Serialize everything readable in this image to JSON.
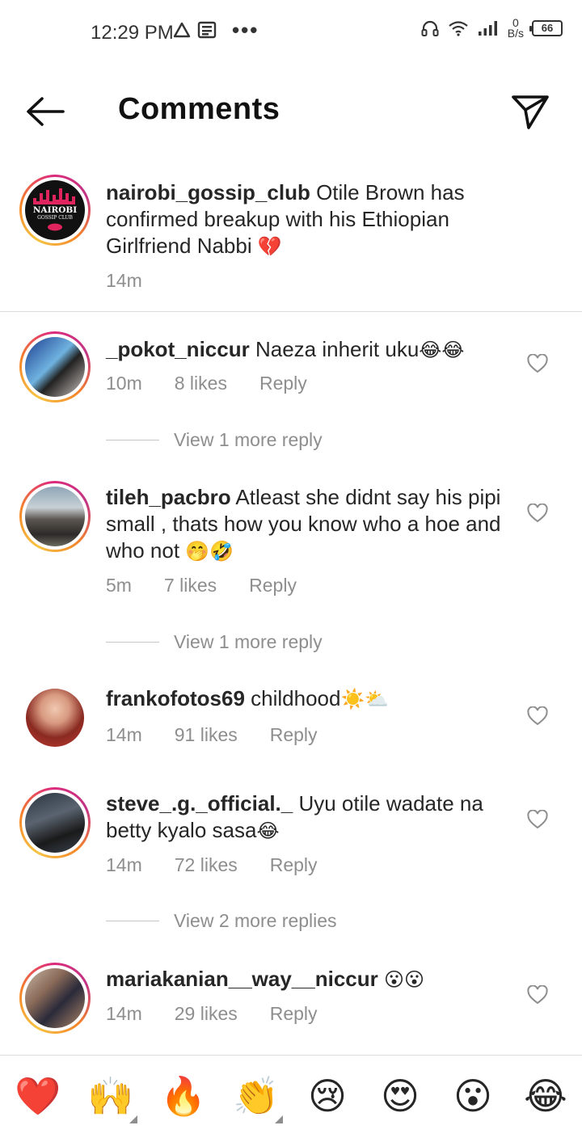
{
  "status_bar": {
    "time": "12:29 PM",
    "speed_top": "0",
    "speed_bottom": "B/s",
    "battery": "66"
  },
  "header": {
    "title": "Comments"
  },
  "caption": {
    "username": "nairobi_gossip_club",
    "text": "Otile Brown has confirmed breakup with his Ethiopian Girlfriend Nabbi",
    "emoji": "💔",
    "time": "14m",
    "avatar_line1": "NAIROBI",
    "avatar_line2": "GOSSIP CLUB"
  },
  "comments": [
    {
      "username": "_pokot_niccur",
      "text": "Naeza inherit uku",
      "emoji": "😂😂",
      "time": "10m",
      "likes": "8 likes",
      "reply": "Reply",
      "view_more": "View 1 more reply"
    },
    {
      "username": "tileh_pacbro",
      "text": "Atleast she didnt say his pipi small , thats how you know who a hoe and who not",
      "emoji": "🤭🤣",
      "time": "5m",
      "likes": "7 likes",
      "reply": "Reply",
      "view_more": "View 1 more reply"
    },
    {
      "username": "frankofotos69",
      "text": "childhood",
      "emoji": "☀️⛅",
      "time": "14m",
      "likes": "91 likes",
      "reply": "Reply"
    },
    {
      "username": "steve_.g._official._",
      "text": "Uyu otile wadate na betty kyalo sasa",
      "emoji": "😂",
      "time": "14m",
      "likes": "72 likes",
      "reply": "Reply",
      "view_more": "View 2 more replies"
    },
    {
      "username": "mariakanian__way__niccur",
      "text": "",
      "emoji": "😮😮",
      "time": "14m",
      "likes": "29 likes",
      "reply": "Reply"
    }
  ],
  "reactions": [
    "❤️",
    "🙌",
    "🔥",
    "👏",
    "😢",
    "😍",
    "😮",
    "😂"
  ],
  "colors": {
    "text": "#262626",
    "muted": "#8e8e8e",
    "divider": "#dbdbdb",
    "ring_start": "#f58529",
    "ring_end": "#dd2a7b"
  }
}
